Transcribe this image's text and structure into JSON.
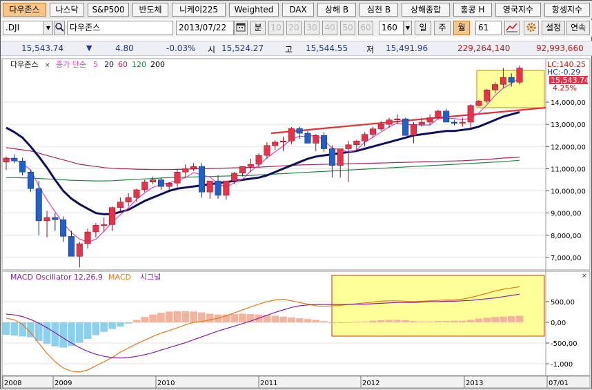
{
  "tabs": [
    "다우존스",
    "나스닥",
    "S&P500",
    "반도체",
    "니케이225",
    "Weighted",
    "DAX",
    "상해 B",
    "심천 B",
    "상해종합",
    "홍콩 H",
    "영국지수",
    "항셍지수"
  ],
  "toolbar": {
    "symbol": ".DJI",
    "name": "다우존스",
    "date": "2013/07/22",
    "period_label": "분",
    "interval_buttons": [
      "10",
      "20",
      "30",
      "40",
      "50",
      "60"
    ],
    "count": "160",
    "day_btn": "일",
    "week_btn": "주",
    "month_btn": "월",
    "bars": "61",
    "settings_label": "설정",
    "continuous_label": "연속"
  },
  "quote": {
    "last": "15,543.74",
    "arrow": "▼",
    "change": "4.80",
    "change_pct": "-0.03%",
    "open_label": "시",
    "open": "15,524.27",
    "high_label": "고",
    "high": "15,544.55",
    "low_label": "저",
    "low": "15,491.96",
    "volume": "229,264,140",
    "amount": "92,993,660"
  },
  "colors": {
    "up": "#e8324a",
    "down": "#2060c8",
    "ma5": "#e040c0",
    "ma20": "#0c0c60",
    "ma60": "#b0205a",
    "ma120": "#208840",
    "ma200": "#3050a0",
    "trend": "#e83030",
    "macd": "#e07818",
    "signal": "#8c1ca8",
    "osc_pos": "#f2b49c",
    "osc_neg": "#8cd0f0",
    "highlight": "#ffff99"
  },
  "chart_data": {
    "type": "line",
    "title": "다우존스",
    "legend_prefix": "종가 단순",
    "legend_periods": [
      "5",
      "20",
      "60",
      "120",
      "200"
    ],
    "x_ticks": [
      "2008",
      "2009",
      "2010",
      "2011",
      "2012",
      "2013",
      "07/01"
    ],
    "y_ticks": [
      "14,000,00",
      "13,000,00",
      "12,000,00",
      "11,000,00",
      "10,000,00",
      "9,000,00",
      "8,000,00",
      "7,000,00"
    ],
    "ylim": [
      6500,
      15900
    ],
    "current_label": "15,543.74",
    "lc_label": "LC:140.25",
    "hc_label": "HC:-0.29",
    "pct_label": "4.25%",
    "ohlc": [
      [
        11300,
        11550,
        10950,
        11480
      ],
      [
        11480,
        11650,
        11250,
        11350
      ],
      [
        11350,
        11500,
        10700,
        10850
      ],
      [
        10850,
        10950,
        9950,
        10100
      ],
      [
        10100,
        10450,
        8000,
        8650
      ],
      [
        8650,
        9100,
        7900,
        8800
      ],
      [
        8800,
        9000,
        8200,
        8700
      ],
      [
        8700,
        8850,
        7700,
        7950
      ],
      [
        7950,
        8200,
        7150,
        7050
      ],
      [
        7050,
        7700,
        6550,
        7620
      ],
      [
        7620,
        8300,
        7400,
        8150
      ],
      [
        8150,
        8550,
        7900,
        8450
      ],
      [
        8450,
        8800,
        8150,
        8480
      ],
      [
        8480,
        9300,
        8200,
        9250
      ],
      [
        9250,
        9700,
        9050,
        9500
      ],
      [
        9500,
        9900,
        9300,
        9700
      ],
      [
        9700,
        10100,
        9500,
        10050
      ],
      [
        10050,
        10500,
        9950,
        10400
      ],
      [
        10400,
        10650,
        10300,
        10500
      ],
      [
        10500,
        10600,
        10050,
        10200
      ],
      [
        10200,
        10400,
        10050,
        10350
      ],
      [
        10350,
        10950,
        10150,
        10850
      ],
      [
        10850,
        11200,
        10600,
        11000
      ],
      [
        11000,
        11250,
        10900,
        11100
      ],
      [
        11100,
        11250,
        9700,
        9950
      ],
      [
        9950,
        10400,
        9650,
        10450
      ],
      [
        10450,
        10700,
        9650,
        9800
      ],
      [
        9800,
        10400,
        9600,
        10450
      ],
      [
        10450,
        10850,
        10300,
        10800
      ],
      [
        10800,
        11100,
        10650,
        11100
      ],
      [
        11100,
        11450,
        10850,
        11200
      ],
      [
        11200,
        11700,
        11050,
        11600
      ],
      [
        11600,
        12200,
        11450,
        12050
      ],
      [
        12050,
        12300,
        11850,
        12200
      ],
      [
        12200,
        12450,
        11800,
        12250
      ],
      [
        12250,
        12880,
        12100,
        12810
      ],
      [
        12810,
        12900,
        12350,
        12600
      ],
      [
        12600,
        12700,
        12300,
        12150
      ],
      [
        12150,
        12550,
        11800,
        12500
      ],
      [
        12500,
        12650,
        11750,
        11900
      ],
      [
        11900,
        12050,
        10600,
        11150
      ],
      [
        11150,
        11900,
        10600,
        11900
      ],
      [
        11900,
        12250,
        10400,
        12080
      ],
      [
        12080,
        12300,
        11800,
        12250
      ],
      [
        12250,
        12650,
        12000,
        12550
      ],
      [
        12550,
        12900,
        12400,
        12800
      ],
      [
        12800,
        13150,
        12700,
        13000
      ],
      [
        13000,
        13300,
        12850,
        13200
      ],
      [
        13200,
        13450,
        13000,
        13250
      ],
      [
        13250,
        13300,
        12550,
        12500
      ],
      [
        12500,
        13100,
        12150,
        13000
      ],
      [
        13000,
        13300,
        12900,
        13100
      ],
      [
        13100,
        13450,
        12950,
        13300
      ],
      [
        13300,
        13650,
        13250,
        13600
      ],
      [
        13600,
        13700,
        13100,
        13100
      ],
      [
        13100,
        13200,
        12950,
        13050
      ],
      [
        13050,
        13300,
        12900,
        13100
      ],
      [
        13100,
        13900,
        12800,
        13850
      ],
      [
        13850,
        14100,
        13800,
        14050
      ],
      [
        14050,
        14600,
        13950,
        14550
      ],
      [
        14550,
        14900,
        14400,
        14800
      ],
      [
        14800,
        15550,
        14650,
        15120
      ],
      [
        15120,
        15300,
        14700,
        14900
      ],
      [
        14900,
        15650,
        14800,
        15540
      ]
    ],
    "ma20_y": [
      12850,
      12650,
      12400,
      12000,
      11550,
      11050,
      10500,
      10000,
      9650,
      9400,
      9200,
      9000,
      8950,
      8950,
      9050,
      9150,
      9350,
      9550,
      9700,
      9850,
      10000,
      10100,
      10150,
      10200,
      10250,
      10300,
      10350,
      10400,
      10450,
      10500,
      10550,
      10600,
      10700,
      10850,
      11000,
      11150,
      11300,
      11450,
      11550,
      11600,
      11650,
      11700,
      11750,
      11800,
      11900,
      12000,
      12100,
      12200,
      12300,
      12400,
      12500,
      12550,
      12600,
      12650,
      12700,
      12700,
      12750,
      12800,
      12900,
      13050,
      13200,
      13350,
      13450,
      13550
    ],
    "ma60_y": [
      11950,
      11900,
      11850,
      11800,
      11700,
      11600,
      11500,
      11400,
      11300,
      11200,
      11150,
      11100,
      11050,
      11020,
      11000,
      10990,
      10980,
      10970,
      10960,
      10960,
      10960,
      10970,
      10980,
      10990,
      11000,
      11010,
      11020,
      11030,
      11040,
      11050,
      11060,
      11070,
      11090,
      11110,
      11130,
      11150,
      11170,
      11180,
      11190,
      11200,
      11210,
      11210,
      11220,
      11230,
      11240,
      11250,
      11260,
      11270,
      11280,
      11290,
      11300,
      11310,
      11320,
      11330,
      11340,
      11350,
      11360,
      11380,
      11400,
      11420,
      11450,
      11480,
      11500,
      11520
    ],
    "ma120_y": [
      10600,
      10600,
      10590,
      10580,
      10560,
      10540,
      10520,
      10500,
      10480,
      10470,
      10460,
      10450,
      10450,
      10460,
      10480,
      10500,
      10520,
      10540,
      10560,
      10580,
      10600,
      10610,
      10620,
      10630,
      10640,
      10650,
      10660,
      10670,
      10680,
      10690,
      10700,
      10720,
      10740,
      10760,
      10780,
      10800,
      10820,
      10840,
      10860,
      10880,
      10900,
      10920,
      10940,
      10960,
      10980,
      11000,
      11020,
      11040,
      11060,
      11080,
      11100,
      11120,
      11140,
      11160,
      11180,
      11200,
      11220,
      11240,
      11260,
      11280,
      11300,
      11320,
      11350,
      11380
    ],
    "osc_ylim": [
      -1250,
      1200
    ],
    "osc_y_ticks": [
      "500,00",
      "0,00",
      "-500,00",
      "-1,000"
    ],
    "osc_title": "MACD Oscillator 12,26,9",
    "macd_label": "MACD",
    "signal_label": "시그널",
    "macd": [
      100,
      60,
      -50,
      -250,
      -500,
      -750,
      -950,
      -1100,
      -1180,
      -1200,
      -1150,
      -1050,
      -950,
      -850,
      -720,
      -620,
      -520,
      -430,
      -340,
      -260,
      -200,
      -130,
      -60,
      0,
      20,
      60,
      100,
      160,
      230,
      300,
      370,
      440,
      500,
      540,
      560,
      520,
      480,
      440,
      400,
      390,
      400,
      410,
      430,
      450,
      470,
      490,
      510,
      520,
      520,
      510,
      500,
      510,
      520,
      530,
      540,
      540,
      560,
      600,
      650,
      700,
      760,
      800,
      830,
      860
    ],
    "signal": [
      200,
      180,
      140,
      70,
      -20,
      -130,
      -250,
      -380,
      -500,
      -610,
      -700,
      -770,
      -820,
      -850,
      -860,
      -850,
      -820,
      -780,
      -730,
      -670,
      -610,
      -550,
      -490,
      -420,
      -350,
      -280,
      -210,
      -150,
      -90,
      -30,
      30,
      100,
      170,
      240,
      300,
      360,
      400,
      420,
      430,
      430,
      430,
      430,
      430,
      440,
      440,
      450,
      460,
      470,
      480,
      480,
      480,
      490,
      500,
      500,
      510,
      510,
      520,
      530,
      550,
      570,
      590,
      620,
      650,
      680
    ],
    "osc": [
      -300,
      -320,
      -340,
      -360,
      -450,
      -520,
      -580,
      -610,
      -570,
      -490,
      -400,
      -310,
      -230,
      -160,
      -100,
      -30,
      60,
      130,
      190,
      230,
      260,
      270,
      270,
      260,
      240,
      210,
      190,
      190,
      200,
      210,
      200,
      190,
      180,
      160,
      140,
      120,
      100,
      80,
      60,
      30,
      -20,
      -10,
      0,
      10,
      20,
      40,
      50,
      60,
      60,
      50,
      30,
      20,
      20,
      30,
      30,
      40,
      40,
      60,
      90,
      110,
      130,
      140,
      150,
      160
    ]
  }
}
